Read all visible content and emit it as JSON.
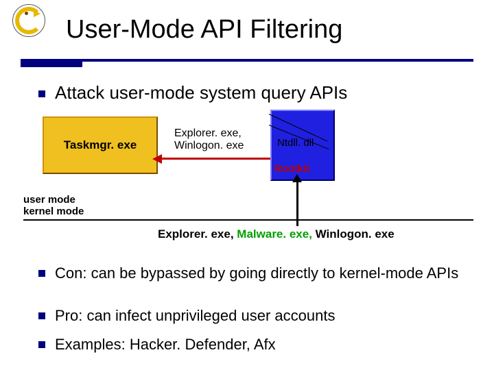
{
  "title": "User-Mode API Filtering",
  "bullet_intro": "Attack user-mode system query APIs",
  "diagram": {
    "taskmgr": "Taskmgr. exe",
    "api_call": "Explorer. exe, Winlogon. exe",
    "ntdll": "Ntdll. dll",
    "rootkit": "Rootkit"
  },
  "mode": {
    "user": "user mode",
    "kernel": "kernel mode"
  },
  "returned": {
    "p1": "Explorer. exe, ",
    "malware": "Malware. exe, ",
    "p2": "Winlogon. exe"
  },
  "bullets": {
    "con": "Con: can be bypassed by going directly to kernel-mode APIs",
    "pro": "Pro: can infect unprivileged user accounts",
    "ex": "Examples: Hacker. Defender, Afx"
  }
}
